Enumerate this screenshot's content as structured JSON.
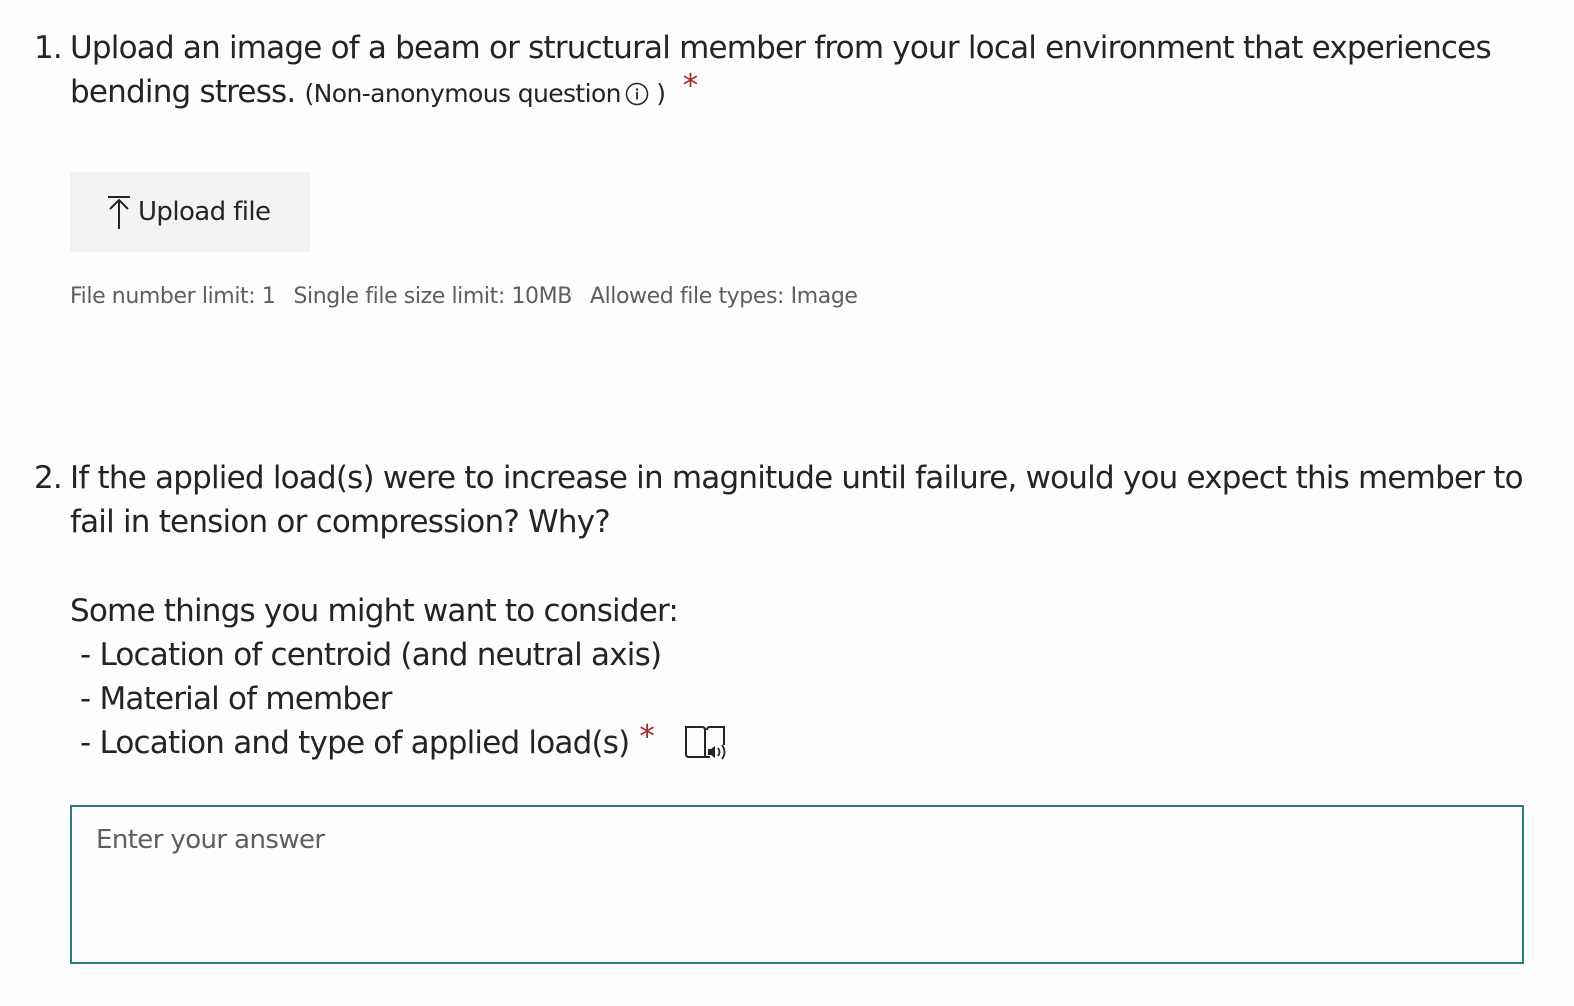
{
  "question1": {
    "number": "1.",
    "text": "Upload an image of a beam or structural member from your local environment that experiences bending stress.",
    "non_anonymous_open": "(Non-anonymous question",
    "non_anonymous_close": ")",
    "required_mark": "*",
    "upload_label": "Upload file",
    "limits": {
      "file_number": "File number limit: 1",
      "file_size": "Single file size limit: 10MB",
      "file_types": "Allowed file types: Image"
    }
  },
  "question2": {
    "number": "2.",
    "text": "If the applied load(s) were to increase in magnitude until failure, would you expect this member to fail in tension or compression? Why?",
    "consider_intro": "Some things you might want to consider:",
    "consider_items": [
      "- Location of centroid (and neutral axis)",
      "- Material of member",
      "- Location and type of applied load(s)"
    ],
    "required_mark": "*",
    "answer_placeholder": "Enter your answer"
  },
  "colors": {
    "required": "#a4262c",
    "answer_border": "#2a7a84",
    "button_bg": "#f3f3f3",
    "meta_text": "#605e5c"
  },
  "icons": [
    "info-icon",
    "upload-icon",
    "immersive-reader-icon"
  ]
}
